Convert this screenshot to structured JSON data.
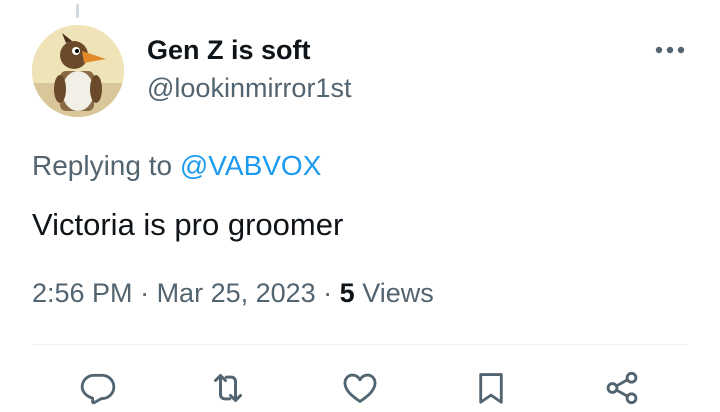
{
  "tweet": {
    "display_name": "Gen Z is soft",
    "handle": "@lookinmirror1st",
    "replying_prefix": "Replying to ",
    "replying_to": "@VABVOX",
    "text": "Victoria is pro groomer",
    "time": "2:56 PM",
    "separator": " · ",
    "date": "Mar 25, 2023",
    "views_count": "5",
    "views_label": " Views"
  },
  "actions": [
    {
      "name": "reply",
      "icon": "reply-icon"
    },
    {
      "name": "retweet",
      "icon": "retweet-icon"
    },
    {
      "name": "like",
      "icon": "heart-icon"
    },
    {
      "name": "bookmark",
      "icon": "bookmark-icon"
    },
    {
      "name": "share",
      "icon": "share-icon"
    }
  ],
  "colors": {
    "text_primary": "#0f1419",
    "text_secondary": "#536471",
    "link": "#1d9bf0",
    "divider": "#eff3f4"
  }
}
